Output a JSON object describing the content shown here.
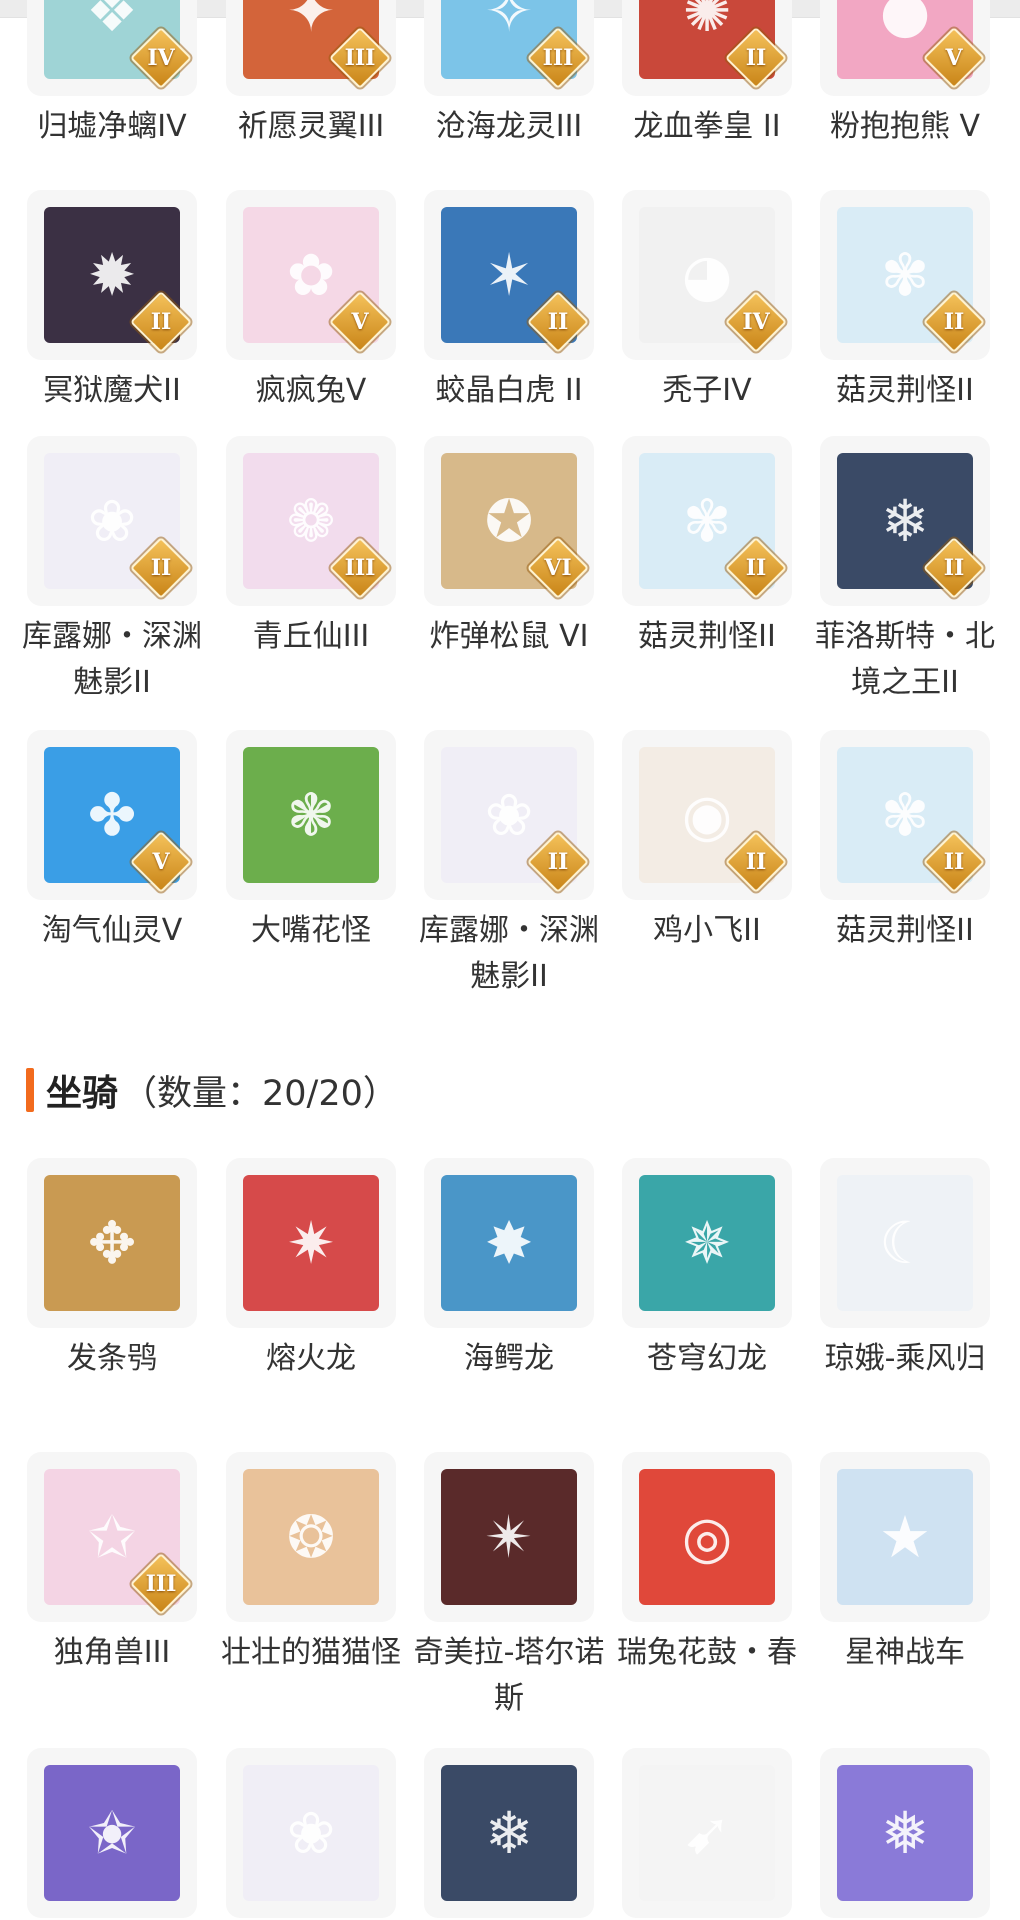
{
  "colors": {
    "accent": "#f26b1d",
    "card_bg": "#f6f6f6",
    "badge": "#e0a030"
  },
  "pets": [
    {
      "label": "归墟净螭IV",
      "badge": "IV",
      "icon": "dragon-icon",
      "bg": "#9fd4d6"
    },
    {
      "label": "祈愿灵翼III",
      "badge": "III",
      "icon": "phoenix-icon",
      "bg": "#d3643a"
    },
    {
      "label": "沧海龙灵III",
      "badge": "III",
      "icon": "sea-spirit-icon",
      "bg": "#7cc4e8"
    },
    {
      "label": "龙血拳皇 II",
      "badge": "II",
      "icon": "beast-icon",
      "bg": "#c9483a"
    },
    {
      "label": "粉抱抱熊 V",
      "badge": "V",
      "icon": "bear-icon",
      "bg": "#f2a7c3"
    },
    {
      "label": "冥狱魔犬II",
      "badge": "II",
      "icon": "demon-dog-icon",
      "bg": "#3b3044"
    },
    {
      "label": "疯疯兔V",
      "badge": "V",
      "icon": "rabbit-icon",
      "bg": "#f5d8e6"
    },
    {
      "label": "蛟晶白虎 II",
      "badge": "II",
      "icon": "white-tiger-icon",
      "bg": "#3a78b8"
    },
    {
      "label": "秃子IV",
      "badge": "IV",
      "icon": "bald-head-icon",
      "bg": "#f1f1f1"
    },
    {
      "label": "菇灵荆怪II",
      "badge": "II",
      "icon": "mushroom-elf-icon",
      "bg": "#d9ecf6"
    },
    {
      "label": "库露娜・深渊魅影II",
      "badge": "II",
      "icon": "phantom-girl-icon",
      "bg": "#f0eef6"
    },
    {
      "label": "青丘仙III",
      "badge": "III",
      "icon": "fox-fairy-icon",
      "bg": "#f2dced"
    },
    {
      "label": "炸弹松鼠 VI",
      "badge": "VI",
      "icon": "squirrel-icon",
      "bg": "#d7b98a"
    },
    {
      "label": "菇灵荆怪II",
      "badge": "II",
      "icon": "mushroom-elf-icon",
      "bg": "#d9ecf6"
    },
    {
      "label": "菲洛斯特・北境之王II",
      "badge": "II",
      "icon": "frost-king-icon",
      "bg": "#3a4a66"
    },
    {
      "label": "淘气仙灵V",
      "badge": "V",
      "icon": "blue-dog-icon",
      "bg": "#3a9ee6"
    },
    {
      "label": "大嘴花怪",
      "badge": "",
      "icon": "flower-monster-icon",
      "bg": "#6cae4c"
    },
    {
      "label": "库露娜・深渊魅影II",
      "badge": "II",
      "icon": "phantom-girl-icon",
      "bg": "#f0eef6"
    },
    {
      "label": "鸡小飞II",
      "badge": "II",
      "icon": "chick-icon",
      "bg": "#f3ece4"
    },
    {
      "label": "菇灵荆怪II",
      "badge": "II",
      "icon": "mushroom-elf-icon",
      "bg": "#d9ecf6"
    }
  ],
  "mounts_section": {
    "title": "坐骑",
    "count": "（数量：20/20）"
  },
  "mounts": [
    {
      "label": "发条鸮",
      "badge": "",
      "icon": "owl-icon",
      "bg": "#c99a52"
    },
    {
      "label": "熔火龙",
      "badge": "",
      "icon": "fire-dragon-icon",
      "bg": "#d64a4a"
    },
    {
      "label": "海鳄龙",
      "badge": "",
      "icon": "sea-dragon-icon",
      "bg": "#4a96c8"
    },
    {
      "label": "苍穹幻龙",
      "badge": "",
      "icon": "sky-dragon-icon",
      "bg": "#3aa6a8"
    },
    {
      "label": "琼娥-乘风归",
      "badge": "",
      "icon": "moon-lady-icon",
      "bg": "#eef2f6"
    },
    {
      "label": "独角兽III",
      "badge": "III",
      "icon": "unicorn-icon",
      "bg": "#f4d4e4"
    },
    {
      "label": "壮壮的猫猫怪",
      "badge": "",
      "icon": "cat-icon",
      "bg": "#e9c29a"
    },
    {
      "label": "奇美拉-塔尔诺斯",
      "badge": "",
      "icon": "chimera-icon",
      "bg": "#5a2a2a"
    },
    {
      "label": "瑞兔花鼓・春",
      "badge": "",
      "icon": "drum-icon",
      "bg": "#e0483a"
    },
    {
      "label": "星神战车",
      "badge": "",
      "icon": "star-horse-icon",
      "bg": "#cfe2f2"
    },
    {
      "label": "",
      "badge": "",
      "icon": "purple-dragon-icon",
      "bg": "#7a66c8"
    },
    {
      "label": "",
      "badge": "",
      "icon": "phantom-girl-icon",
      "bg": "#f0eef6"
    },
    {
      "label": "",
      "badge": "",
      "icon": "frost-king-icon",
      "bg": "#3a4a66"
    },
    {
      "label": "",
      "badge": "",
      "icon": "shovel-icon",
      "bg": "#f4f4f4"
    },
    {
      "label": "",
      "badge": "",
      "icon": "snow-owl-icon",
      "bg": "#8a7ad8"
    }
  ]
}
